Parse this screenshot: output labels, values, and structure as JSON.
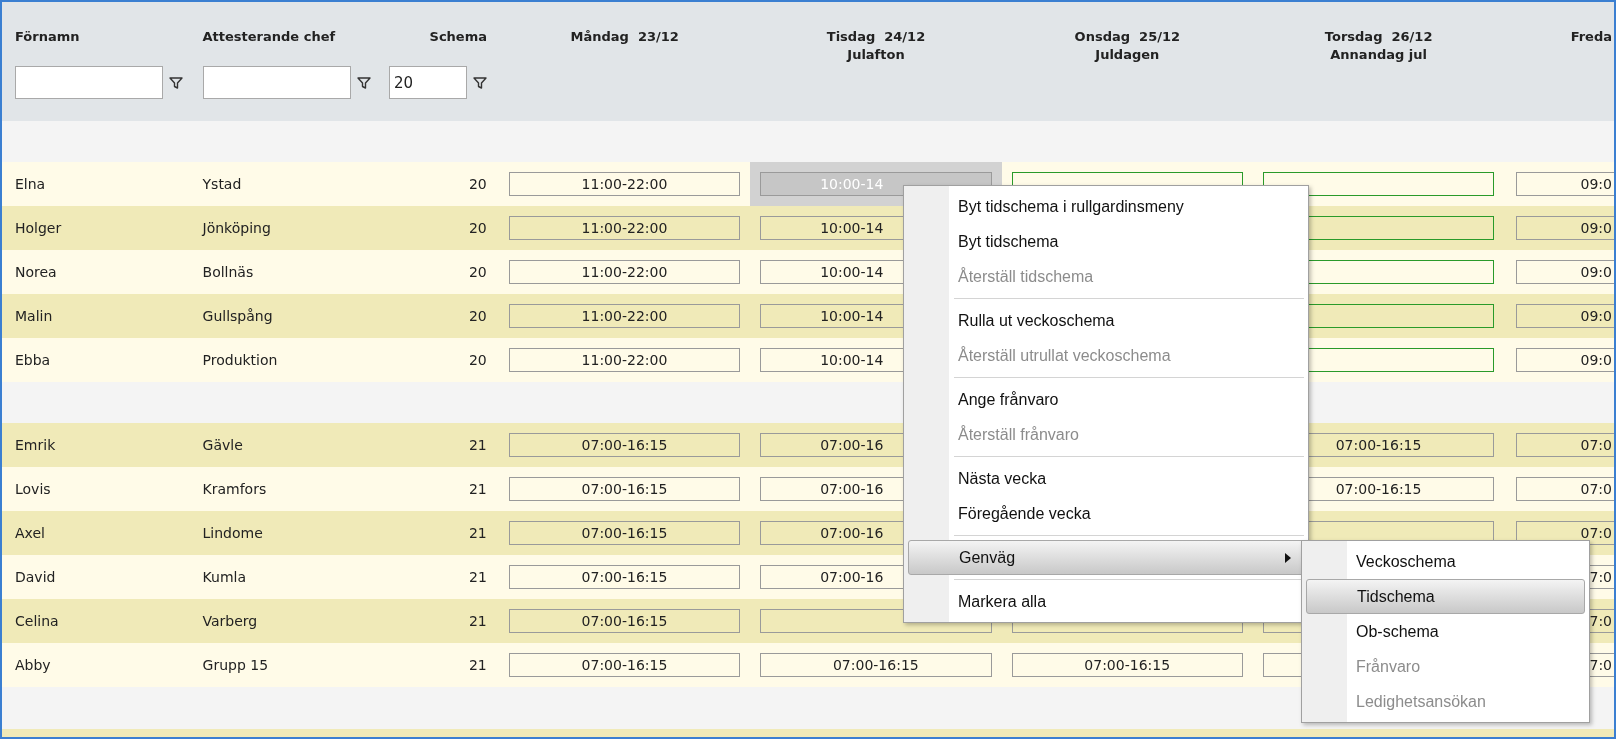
{
  "columns": [
    {
      "label": "Förnamn",
      "filter": true
    },
    {
      "label": "Attesterande chef",
      "filter": true
    },
    {
      "label": "Schema",
      "filter": true,
      "filter_value": "20"
    }
  ],
  "days": [
    {
      "label": "Måndag  23/12",
      "cut": false
    },
    {
      "label": "Tisdag  24/12",
      "holiday": "Julafton",
      "cut": false
    },
    {
      "label": "Onsdag  25/12",
      "holiday": "Juldagen",
      "cut": false
    },
    {
      "label": "Torsdag  26/12",
      "holiday": "Annandag jul",
      "cut": false
    },
    {
      "label": "Freda",
      "cut": true
    }
  ],
  "groups": [
    {
      "rows": [
        {
          "name": "Elna",
          "chef": "Ystad",
          "schema": "20",
          "cells": [
            {
              "text": "11:00-22:00",
              "selected": false,
              "highlight": false,
              "cut": false
            },
            {
              "text": "10:00-14",
              "selected": true,
              "highlight": false,
              "cut": true
            },
            {
              "selected": false,
              "highlight": true
            },
            {
              "selected": false,
              "highlight": true
            },
            {
              "text": "09:0",
              "selected": false,
              "highlight": false
            }
          ]
        },
        {
          "name": "Holger",
          "chef": "Jönköping",
          "schema": "20",
          "cells": [
            {
              "text": "11:00-22:00",
              "selected": false,
              "highlight": false,
              "cut": false
            },
            {
              "text": "10:00-14",
              "selected": false,
              "highlight": false,
              "cut": true
            },
            null,
            {
              "selected": false,
              "highlight": true
            },
            {
              "text": "09:0",
              "selected": false,
              "highlight": false
            }
          ]
        },
        {
          "name": "Norea",
          "chef": "Bollnäs",
          "schema": "20",
          "cells": [
            {
              "text": "11:00-22:00",
              "selected": false,
              "highlight": false,
              "cut": false
            },
            {
              "text": "10:00-14",
              "selected": false,
              "highlight": false,
              "cut": true
            },
            null,
            {
              "selected": false,
              "highlight": true
            },
            {
              "text": "09:0",
              "selected": false,
              "highlight": false
            }
          ]
        },
        {
          "name": "Malin",
          "chef": "Gullspång",
          "schema": "20",
          "cells": [
            {
              "text": "11:00-22:00",
              "selected": false,
              "highlight": false,
              "cut": false
            },
            {
              "text": "10:00-14",
              "selected": false,
              "highlight": false,
              "cut": true
            },
            null,
            {
              "selected": false,
              "highlight": true
            },
            {
              "text": "09:0",
              "selected": false,
              "highlight": false
            }
          ]
        },
        {
          "name": "Ebba",
          "chef": "Produktion",
          "schema": "20",
          "cells": [
            {
              "text": "11:00-22:00",
              "selected": false,
              "highlight": false,
              "cut": false
            },
            {
              "text": "10:00-14",
              "selected": false,
              "highlight": false,
              "cut": true
            },
            null,
            {
              "selected": false,
              "highlight": true
            },
            {
              "text": "09:0",
              "selected": false,
              "highlight": false
            }
          ]
        }
      ]
    },
    {
      "rows": [
        {
          "name": "Emrik",
          "chef": "Gävle",
          "schema": "21",
          "cells": [
            {
              "text": "07:00-16:15",
              "selected": false,
              "highlight": false,
              "cut": false
            },
            {
              "text": "07:00-16",
              "selected": false,
              "highlight": false,
              "cut": true
            },
            null,
            {
              "text": "07:00-16:15",
              "selected": false,
              "highlight": false,
              "cut": false
            },
            {
              "text": "07:0",
              "selected": false,
              "highlight": false
            }
          ]
        },
        {
          "name": "Lovis",
          "chef": "Kramfors",
          "schema": "21",
          "cells": [
            {
              "text": "07:00-16:15",
              "selected": false,
              "highlight": false,
              "cut": false
            },
            {
              "text": "07:00-16",
              "selected": false,
              "highlight": false,
              "cut": true
            },
            null,
            {
              "text": "07:00-16:15",
              "selected": false,
              "highlight": false,
              "cut": false
            },
            {
              "text": "07:0",
              "selected": false,
              "highlight": false
            }
          ]
        },
        {
          "name": "Axel",
          "chef": "Lindome",
          "schema": "21",
          "cells": [
            {
              "text": "07:00-16:15",
              "selected": false,
              "highlight": false,
              "cut": false
            },
            {
              "text": "07:00-16",
              "selected": false,
              "highlight": false,
              "cut": true
            },
            null,
            {
              "selected": false,
              "highlight": false
            },
            {
              "text": "07:0",
              "selected": false,
              "highlight": false
            }
          ]
        },
        {
          "name": "David",
          "chef": "Kumla",
          "schema": "21",
          "cells": [
            {
              "text": "07:00-16:15",
              "selected": false,
              "highlight": false,
              "cut": false
            },
            {
              "text": "07:00-16",
              "selected": false,
              "highlight": false,
              "cut": true
            },
            null,
            null,
            {
              "text": "7:0",
              "selected": false,
              "highlight": false
            }
          ]
        },
        {
          "name": "Celina",
          "chef": "Varberg",
          "schema": "21",
          "cells": [
            {
              "text": "07:00-16:15",
              "selected": false,
              "highlight": false,
              "cut": false
            },
            {
              "selected": false,
              "highlight": false
            },
            {
              "selected": false,
              "highlight": false
            },
            {
              "selected": false,
              "highlight": false
            },
            {
              "text": "7:0",
              "selected": false,
              "highlight": false
            }
          ]
        },
        {
          "name": "Abby",
          "chef": "Grupp 15",
          "schema": "21",
          "cells": [
            {
              "text": "07:00-16:15",
              "selected": false,
              "highlight": false,
              "cut": false
            },
            {
              "text": "07:00-16:15",
              "selected": false,
              "highlight": false,
              "cut": false
            },
            {
              "text": "07:00-16:15",
              "selected": false,
              "highlight": false,
              "cut": false
            },
            {
              "selected": false,
              "highlight": false
            },
            {
              "text": "7:0",
              "selected": false,
              "highlight": false
            }
          ]
        }
      ]
    }
  ],
  "context_menu": {
    "items": [
      {
        "kind": "item",
        "label": "Byt tidschema i rullgardinsmeny",
        "disabled": false,
        "highlighted": false
      },
      {
        "kind": "item",
        "label": "Byt tidschema",
        "disabled": false,
        "highlighted": false
      },
      {
        "kind": "item",
        "label": "Återställ tidschema",
        "disabled": true,
        "highlighted": false
      },
      {
        "kind": "separator"
      },
      {
        "kind": "item",
        "label": "Rulla ut veckoschema",
        "disabled": false,
        "highlighted": false
      },
      {
        "kind": "item",
        "label": "Återställ utrullat veckoschema",
        "disabled": true,
        "highlighted": false
      },
      {
        "kind": "separator"
      },
      {
        "kind": "item",
        "label": "Ange frånvaro",
        "disabled": false,
        "highlighted": false
      },
      {
        "kind": "item",
        "label": "Återställ frånvaro",
        "disabled": true,
        "highlighted": false
      },
      {
        "kind": "separator"
      },
      {
        "kind": "item",
        "label": "Nästa vecka",
        "disabled": false,
        "highlighted": false
      },
      {
        "kind": "item",
        "label": "Föregående vecka",
        "disabled": false,
        "highlighted": false
      },
      {
        "kind": "separator"
      },
      {
        "kind": "submenu",
        "label": "Genväg",
        "disabled": false,
        "highlighted": true
      },
      {
        "kind": "separator"
      },
      {
        "kind": "item",
        "label": "Markera alla",
        "disabled": false,
        "highlighted": false
      }
    ]
  },
  "submenu": {
    "items": [
      {
        "kind": "item",
        "label": "Veckoschema",
        "disabled": false,
        "highlighted": false
      },
      {
        "kind": "item",
        "label": "Tidschema",
        "disabled": false,
        "highlighted": true
      },
      {
        "kind": "item",
        "label": "Ob-schema",
        "disabled": false,
        "highlighted": false
      },
      {
        "kind": "item",
        "label": "Frånvaro",
        "disabled": true,
        "highlighted": false
      },
      {
        "kind": "item",
        "label": "Ledighetsansökan",
        "disabled": true,
        "highlighted": false
      }
    ]
  }
}
